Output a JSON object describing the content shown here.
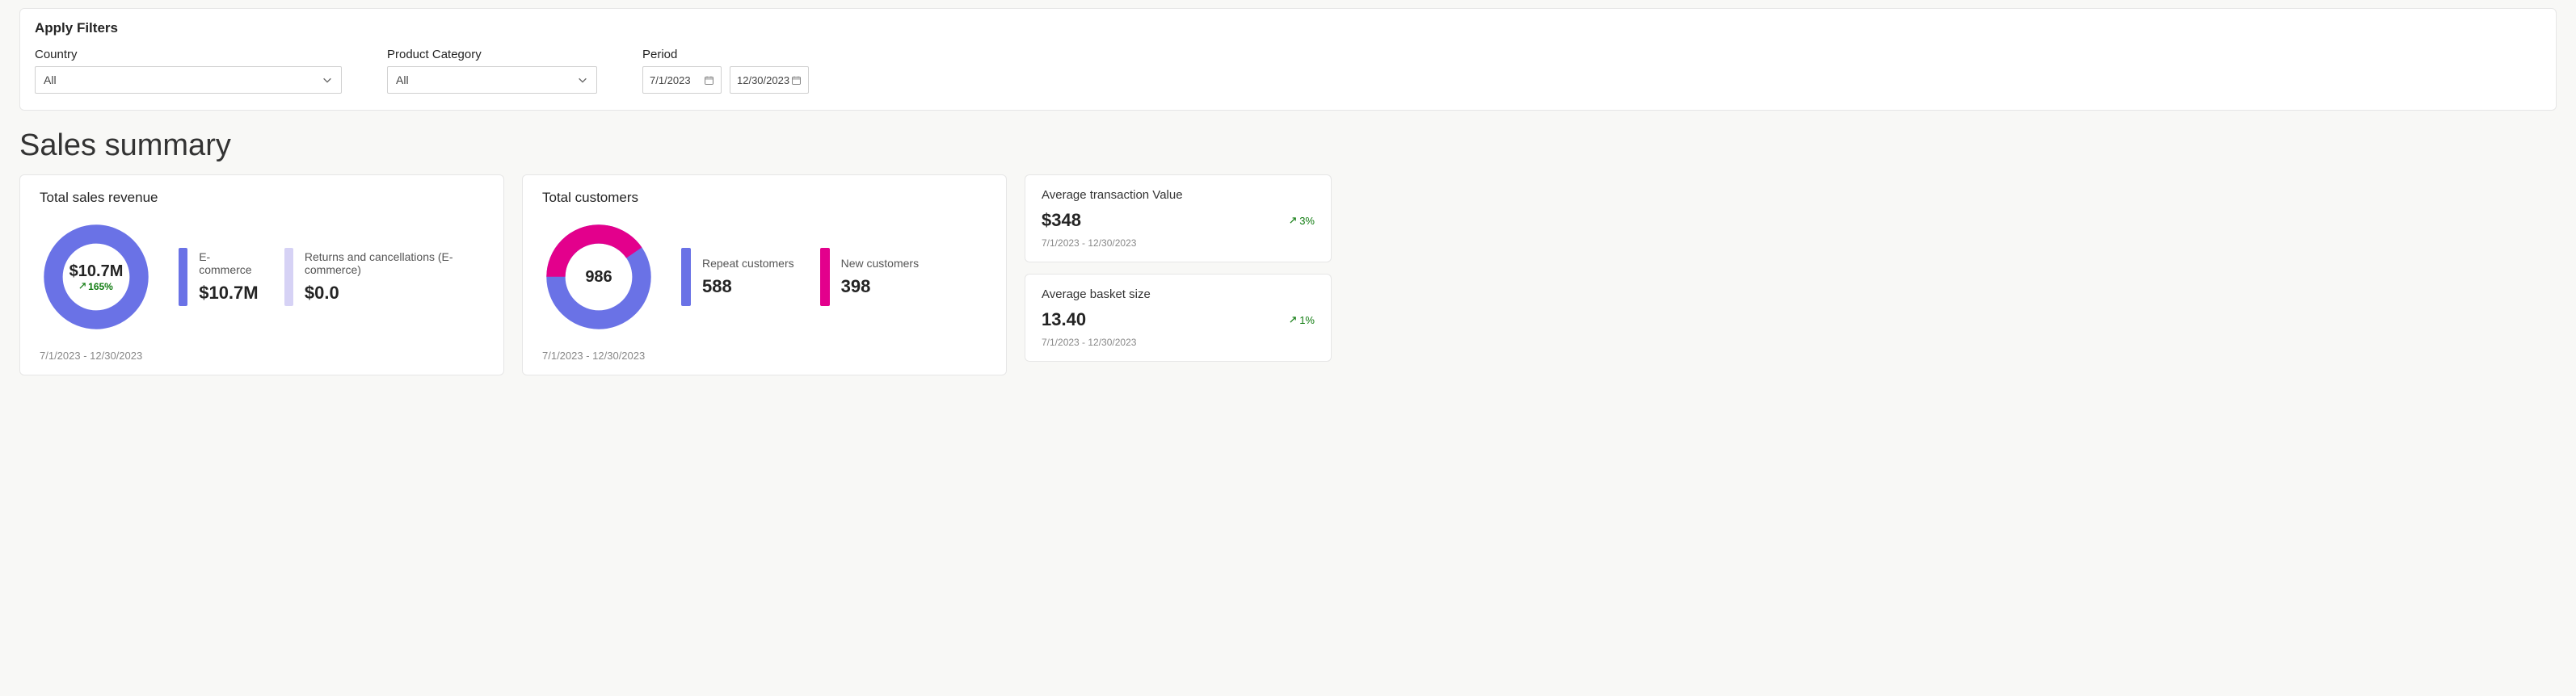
{
  "filters": {
    "title": "Apply Filters",
    "country": {
      "label": "Country",
      "value": "All"
    },
    "category": {
      "label": "Product Category",
      "value": "All"
    },
    "period": {
      "label": "Period",
      "start": "7/1/2023",
      "end": "12/30/2023"
    }
  },
  "page_title": "Sales summary",
  "revenue_card": {
    "title": "Total sales revenue",
    "total": "$10.7M",
    "delta": "165%",
    "series": [
      {
        "label": "E-commerce",
        "value": "$10.7M",
        "color": "#6a72e6"
      },
      {
        "label": "Returns and cancellations (E-commerce)",
        "value": "$0.0",
        "color": "#d6d2f5"
      }
    ],
    "date_range": "7/1/2023 - 12/30/2023"
  },
  "customers_card": {
    "title": "Total customers",
    "total": "986",
    "series": [
      {
        "label": "Repeat customers",
        "value": "588",
        "color": "#6a72e6"
      },
      {
        "label": "New customers",
        "value": "398",
        "color": "#e3008c"
      }
    ],
    "date_range": "7/1/2023 - 12/30/2023"
  },
  "avg_transaction": {
    "title": "Average transaction Value",
    "value": "$348",
    "delta": "3%",
    "date_range": "7/1/2023 - 12/30/2023"
  },
  "avg_basket": {
    "title": "Average basket size",
    "value": "13.40",
    "delta": "1%",
    "date_range": "7/1/2023 - 12/30/2023"
  },
  "chart_data": [
    {
      "type": "pie",
      "title": "Total sales revenue",
      "series": [
        {
          "name": "E-commerce",
          "value": 10.7,
          "unit": "M USD"
        },
        {
          "name": "Returns and cancellations (E-commerce)",
          "value": 0.0,
          "unit": "M USD"
        }
      ],
      "total_label": "$10.7M",
      "delta_pct": 165
    },
    {
      "type": "pie",
      "title": "Total customers",
      "series": [
        {
          "name": "Repeat customers",
          "value": 588
        },
        {
          "name": "New customers",
          "value": 398
        }
      ],
      "total_label": "986"
    }
  ]
}
